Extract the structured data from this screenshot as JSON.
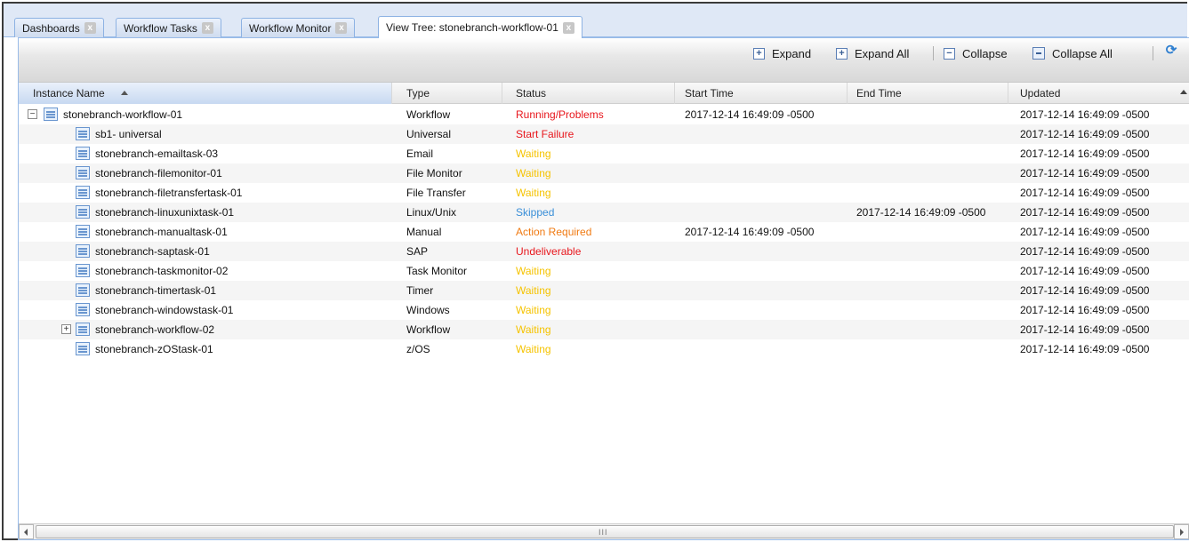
{
  "tabs": [
    {
      "label": "Dashboards",
      "close": "x",
      "active": false
    },
    {
      "label": "Workflow Tasks",
      "close": "x",
      "active": false
    },
    {
      "label": "Workflow Monitor",
      "close": "x",
      "active": false
    },
    {
      "label": "View Tree: stonebranch-workflow-01",
      "close": "x",
      "active": true
    }
  ],
  "toolbar": {
    "expand": "Expand",
    "expand_all": "Expand All",
    "collapse": "Collapse",
    "collapse_all": "Collapse All",
    "refresh_icon": "refresh-icon"
  },
  "columns": {
    "instance_name": "Instance Name",
    "type": "Type",
    "status": "Status",
    "start_time": "Start Time",
    "end_time": "End Time",
    "updated": "Updated"
  },
  "status_colors": {
    "Running/Problems": "#e8161c",
    "Start Failure": "#e8161c",
    "Waiting": "#f5c300",
    "Skipped": "#3a8fd8",
    "Action Required": "#f07a12",
    "Undeliverable": "#e8161c"
  },
  "rows": [
    {
      "name": "stonebranch-workflow-01",
      "type": "Workflow",
      "status": "Running/Problems",
      "start": "2017-12-14 16:49:09 -0500",
      "end": "",
      "updated": "2017-12-14 16:49:09 -0500",
      "level": 0,
      "expander": "−"
    },
    {
      "name": "sb1- universal",
      "type": "Universal",
      "status": "Start Failure",
      "start": "",
      "end": "",
      "updated": "2017-12-14 16:49:09 -0500",
      "level": 1,
      "expander": ""
    },
    {
      "name": "stonebranch-emailtask-03",
      "type": "Email",
      "status": "Waiting",
      "start": "",
      "end": "",
      "updated": "2017-12-14 16:49:09 -0500",
      "level": 1,
      "expander": ""
    },
    {
      "name": "stonebranch-filemonitor-01",
      "type": "File Monitor",
      "status": "Waiting",
      "start": "",
      "end": "",
      "updated": "2017-12-14 16:49:09 -0500",
      "level": 1,
      "expander": ""
    },
    {
      "name": "stonebranch-filetransfertask-01",
      "type": "File Transfer",
      "status": "Waiting",
      "start": "",
      "end": "",
      "updated": "2017-12-14 16:49:09 -0500",
      "level": 1,
      "expander": ""
    },
    {
      "name": "stonebranch-linuxunixtask-01",
      "type": "Linux/Unix",
      "status": "Skipped",
      "start": "",
      "end": "2017-12-14 16:49:09 -0500",
      "updated": "2017-12-14 16:49:09 -0500",
      "level": 1,
      "expander": ""
    },
    {
      "name": "stonebranch-manualtask-01",
      "type": "Manual",
      "status": "Action Required",
      "start": "2017-12-14 16:49:09 -0500",
      "end": "",
      "updated": "2017-12-14 16:49:09 -0500",
      "level": 1,
      "expander": ""
    },
    {
      "name": "stonebranch-saptask-01",
      "type": "SAP",
      "status": "Undeliverable",
      "start": "",
      "end": "",
      "updated": "2017-12-14 16:49:09 -0500",
      "level": 1,
      "expander": ""
    },
    {
      "name": "stonebranch-taskmonitor-02",
      "type": "Task Monitor",
      "status": "Waiting",
      "start": "",
      "end": "",
      "updated": "2017-12-14 16:49:09 -0500",
      "level": 1,
      "expander": ""
    },
    {
      "name": "stonebranch-timertask-01",
      "type": "Timer",
      "status": "Waiting",
      "start": "",
      "end": "",
      "updated": "2017-12-14 16:49:09 -0500",
      "level": 1,
      "expander": ""
    },
    {
      "name": "stonebranch-windowstask-01",
      "type": "Windows",
      "status": "Waiting",
      "start": "",
      "end": "",
      "updated": "2017-12-14 16:49:09 -0500",
      "level": 1,
      "expander": ""
    },
    {
      "name": "stonebranch-workflow-02",
      "type": "Workflow",
      "status": "Waiting",
      "start": "",
      "end": "",
      "updated": "2017-12-14 16:49:09 -0500",
      "level": 1,
      "expander": "+"
    },
    {
      "name": "stonebranch-zOStask-01",
      "type": "z/OS",
      "status": "Waiting",
      "start": "",
      "end": "",
      "updated": "2017-12-14 16:49:09 -0500",
      "level": 1,
      "expander": ""
    }
  ],
  "scrollbar": {
    "grip": "III"
  }
}
